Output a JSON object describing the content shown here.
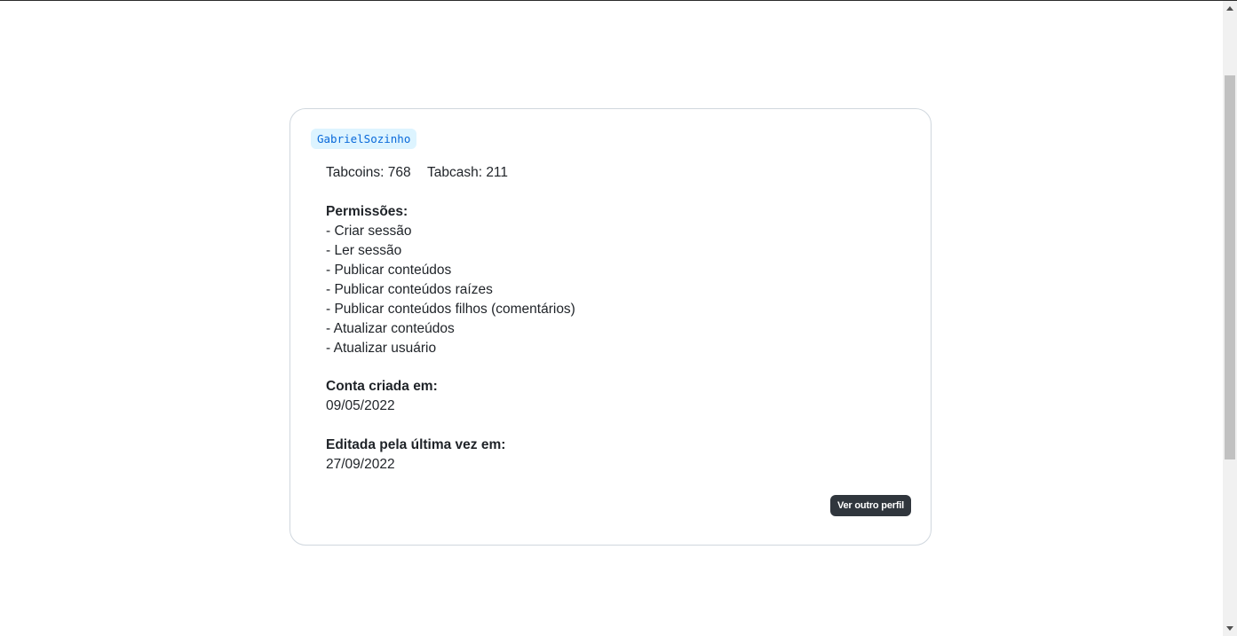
{
  "profile": {
    "username": "GabrielSozinho",
    "tabcoins_label": "Tabcoins: 768",
    "tabcash_label": "Tabcash: 211",
    "permissions_title": "Permissões:",
    "permissions": [
      "- Criar sessão",
      "- Ler sessão",
      "- Publicar conteúdos",
      "- Publicar conteúdos raízes",
      "- Publicar conteúdos filhos (comentários)",
      "- Atualizar conteúdos",
      "- Atualizar usuário"
    ],
    "created_title": "Conta criada em:",
    "created_date": "09/05/2022",
    "edited_title": "Editada pela última vez em:",
    "edited_date": "27/09/2022",
    "other_profile_button": "Ver outro perfil"
  }
}
